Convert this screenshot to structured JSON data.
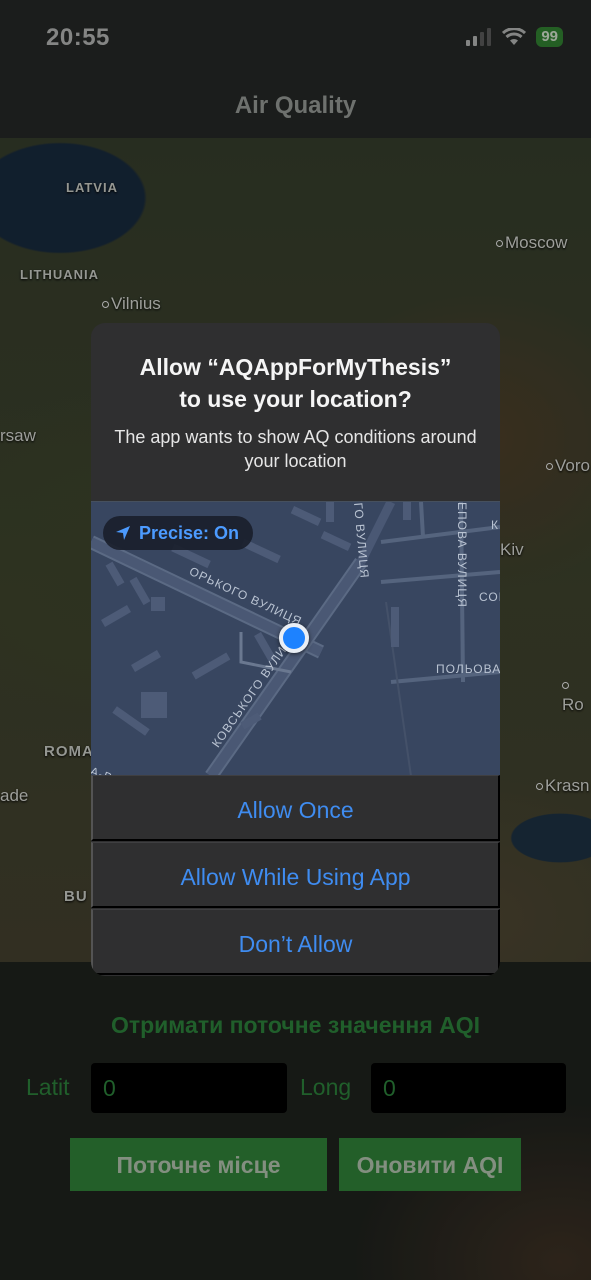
{
  "status_bar": {
    "time": "20:55",
    "battery": "99",
    "icons": [
      "signal-icon",
      "wifi-icon",
      "battery-icon"
    ]
  },
  "navbar": {
    "title": "Air Quality"
  },
  "map": {
    "country_labels": [
      "LATVIA",
      "LITHUANIA",
      "ROMA",
      "BU"
    ],
    "city_labels": [
      "Moscow",
      "Vilnius",
      "rsaw",
      "Voro",
      "Kiv",
      "Ro",
      "Krasn",
      "ade"
    ]
  },
  "alert": {
    "title": "Allow “AQAppForMyThesis”\nto use your location?",
    "message": "The app wants to show AQ conditions around your location",
    "precise": "Precise: On",
    "streets": [
      "ОРЬКОГО ВУЛИЦЯ",
      "КОВСЬКОГО ВУЛИЦЯ",
      "ГО ВУЛИЦЯ",
      "ЕПОВА ВУЛИЦЯ",
      "ПОЛЬОВА",
      "СОН",
      "К",
      "А-В"
    ],
    "buttons": {
      "allow_once": "Allow Once",
      "allow_while_using": "Allow While Using App",
      "dont_allow": "Don’t Allow"
    }
  },
  "panel": {
    "heading": "Отримати поточне значення AQI",
    "lat_label": "Latit",
    "lat_value": "0",
    "long_label": "Long",
    "long_value": "0",
    "current_place_button": "Поточне місце",
    "update_aqi_button": "Оновити AQI"
  },
  "colors": {
    "accent_green": "#2a7a38",
    "alert_blue": "#3f8cf0",
    "location_blue": "#1d82ff"
  }
}
